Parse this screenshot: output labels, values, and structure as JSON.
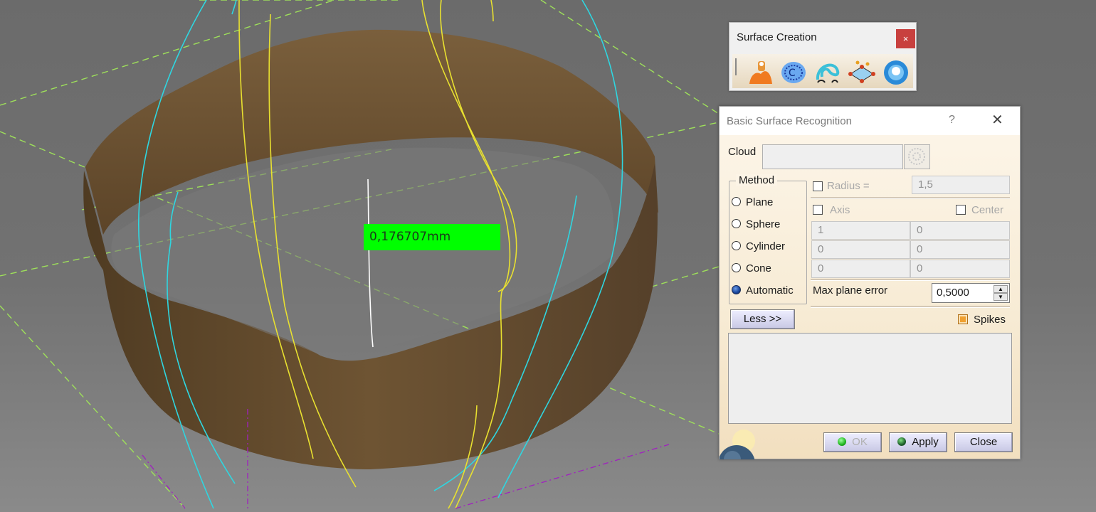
{
  "viewport": {
    "measurement_label": "0,176707mm",
    "surface_color": "#6e5433",
    "curve_colors": {
      "cyan": "#2fd6e0",
      "yellow": "#e8e030",
      "green_dash": "#9ee05a",
      "white": "#ffffff",
      "purple_dash": "#a020c0"
    }
  },
  "toolbar": {
    "title": "Surface Creation",
    "close_label": "×",
    "icons": [
      "point-cloud-surface-icon",
      "cloud-recognition-icon",
      "curve-section-icon",
      "mesh-network-icon",
      "surface-sphere-icon"
    ]
  },
  "dialog": {
    "title": "Basic Surface Recognition",
    "help_label": "?",
    "close_label": "✕",
    "cloud_label": "Cloud",
    "method_label": "Method",
    "methods": [
      "Plane",
      "Sphere",
      "Cylinder",
      "Cone",
      "Automatic"
    ],
    "selected_method": "Automatic",
    "radius_label": "Radius =",
    "radius_value": "1,5",
    "axis_label": "Axis",
    "center_label": "Center",
    "axis_values": [
      [
        "1",
        "0"
      ],
      [
        "0",
        "0"
      ],
      [
        "0",
        "0"
      ]
    ],
    "max_plane_error_label": "Max plane error",
    "max_plane_error_value": "0,5000",
    "less_button": "Less >>",
    "spikes_label": "Spikes",
    "spikes_checked": true,
    "ok_button": "OK",
    "apply_button": "Apply",
    "close_button": "Close"
  }
}
